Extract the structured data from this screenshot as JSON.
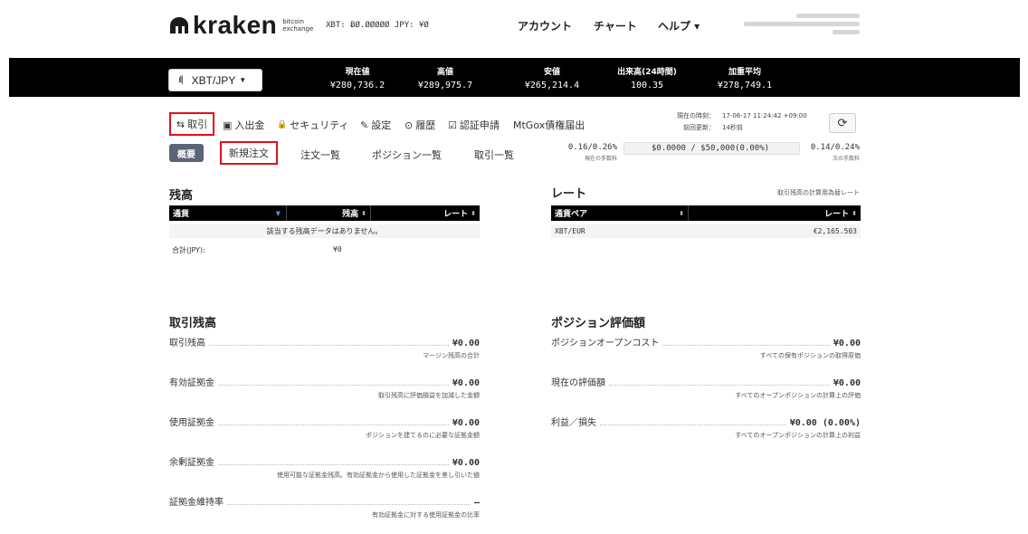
{
  "header": {
    "logo_text": "kraken",
    "logo_sub_line1": "bitcoin",
    "logo_sub_line2": "exchange",
    "balances": "XBT: ɃØ.ØØØØØ   JPY: ¥Ø",
    "nav": {
      "account": "アカウント",
      "chart": "チャート",
      "help": "ヘルプ ▾"
    }
  },
  "ticker": {
    "pair": "XBT/JPY",
    "stats": [
      {
        "label": "現在値",
        "value": "¥280,736.2"
      },
      {
        "label": "高値",
        "value": "¥289,975.7"
      },
      {
        "label": "安値",
        "value": "¥265,214.4"
      },
      {
        "label": "出来高(24時間)",
        "value": "100.35"
      },
      {
        "label": "加重平均",
        "value": "¥278,749.1"
      }
    ]
  },
  "subnav": {
    "items": [
      {
        "icon": "⇆",
        "label": "取引"
      },
      {
        "icon": "▣",
        "label": "入出金"
      },
      {
        "icon": "🔒",
        "label": "セキュリティ"
      },
      {
        "icon": "✎",
        "label": "設定"
      },
      {
        "icon": "⊙",
        "label": "履歴"
      },
      {
        "icon": "☑",
        "label": "認証申請"
      },
      {
        "icon": "",
        "label": "MtGox債権届出"
      }
    ],
    "time_label": "現在の時刻：",
    "time_value": "17-06-17 11:24:42 +09:00",
    "updated_label": "前回更新：",
    "updated_value": "14秒前"
  },
  "tabs": {
    "overview": "概要",
    "new_order": "新規注文",
    "orders": "注文一覧",
    "positions": "ポジション一覧",
    "trades": "取引一覧"
  },
  "fees": {
    "current_value": "0.16/0.26%",
    "current_label": "現在の手数料",
    "progress_text": "$0.0000 / $50,000(0.00%)",
    "progress_fraction": 0.0,
    "next_value": "0.14/0.24%",
    "next_label": "次の手数料"
  },
  "balance": {
    "title": "残高",
    "headers": {
      "currency": "通貨",
      "balance": "残高",
      "rate": "レート"
    },
    "empty": "該当する残高データはありません。",
    "total_label": "合計(JPY):",
    "total_value": "¥0"
  },
  "rates": {
    "title": "レート",
    "note": "取引残高の計算用為替レート",
    "headers": {
      "pair": "通貨ペア",
      "rate": "レート"
    },
    "rows": [
      {
        "pair": "XBT/EUR",
        "rate": "€2,165.503"
      }
    ]
  },
  "trade_balance": {
    "title": "取引残高",
    "rows": [
      {
        "label": "取引残高",
        "value": "¥0.00",
        "desc": "マージン残高の合計"
      },
      {
        "label": "有効証拠金",
        "value": "¥0.00",
        "desc": "取引残高に評価損益を加減した金額"
      },
      {
        "label": "使用証拠金",
        "value": "¥0.00",
        "desc": "ポジションを建てるのに必要な証拠金額"
      },
      {
        "label": "余剰証拠金",
        "value": "¥0.00",
        "desc": "使用可能な証拠金残高。有効証拠金から使用した証拠金を差し引いた値"
      },
      {
        "label": "証拠金維持率",
        "value": "—",
        "desc": "有効証拠金に対する使用証拠金の比率"
      }
    ]
  },
  "position_valuation": {
    "title": "ポジション評価額",
    "rows": [
      {
        "label": "ポジションオープンコスト",
        "value": "¥0.00",
        "desc": "すべての保有ポジションの取得原価"
      },
      {
        "label": "現在の評価額",
        "value": "¥0.00",
        "desc": "すべてのオープンポジションの計算上の評価"
      },
      {
        "label": "利益／損失",
        "value": "¥0.00 (0.00%)",
        "desc": "すべてのオープンポジションの計算上の利益"
      }
    ]
  }
}
